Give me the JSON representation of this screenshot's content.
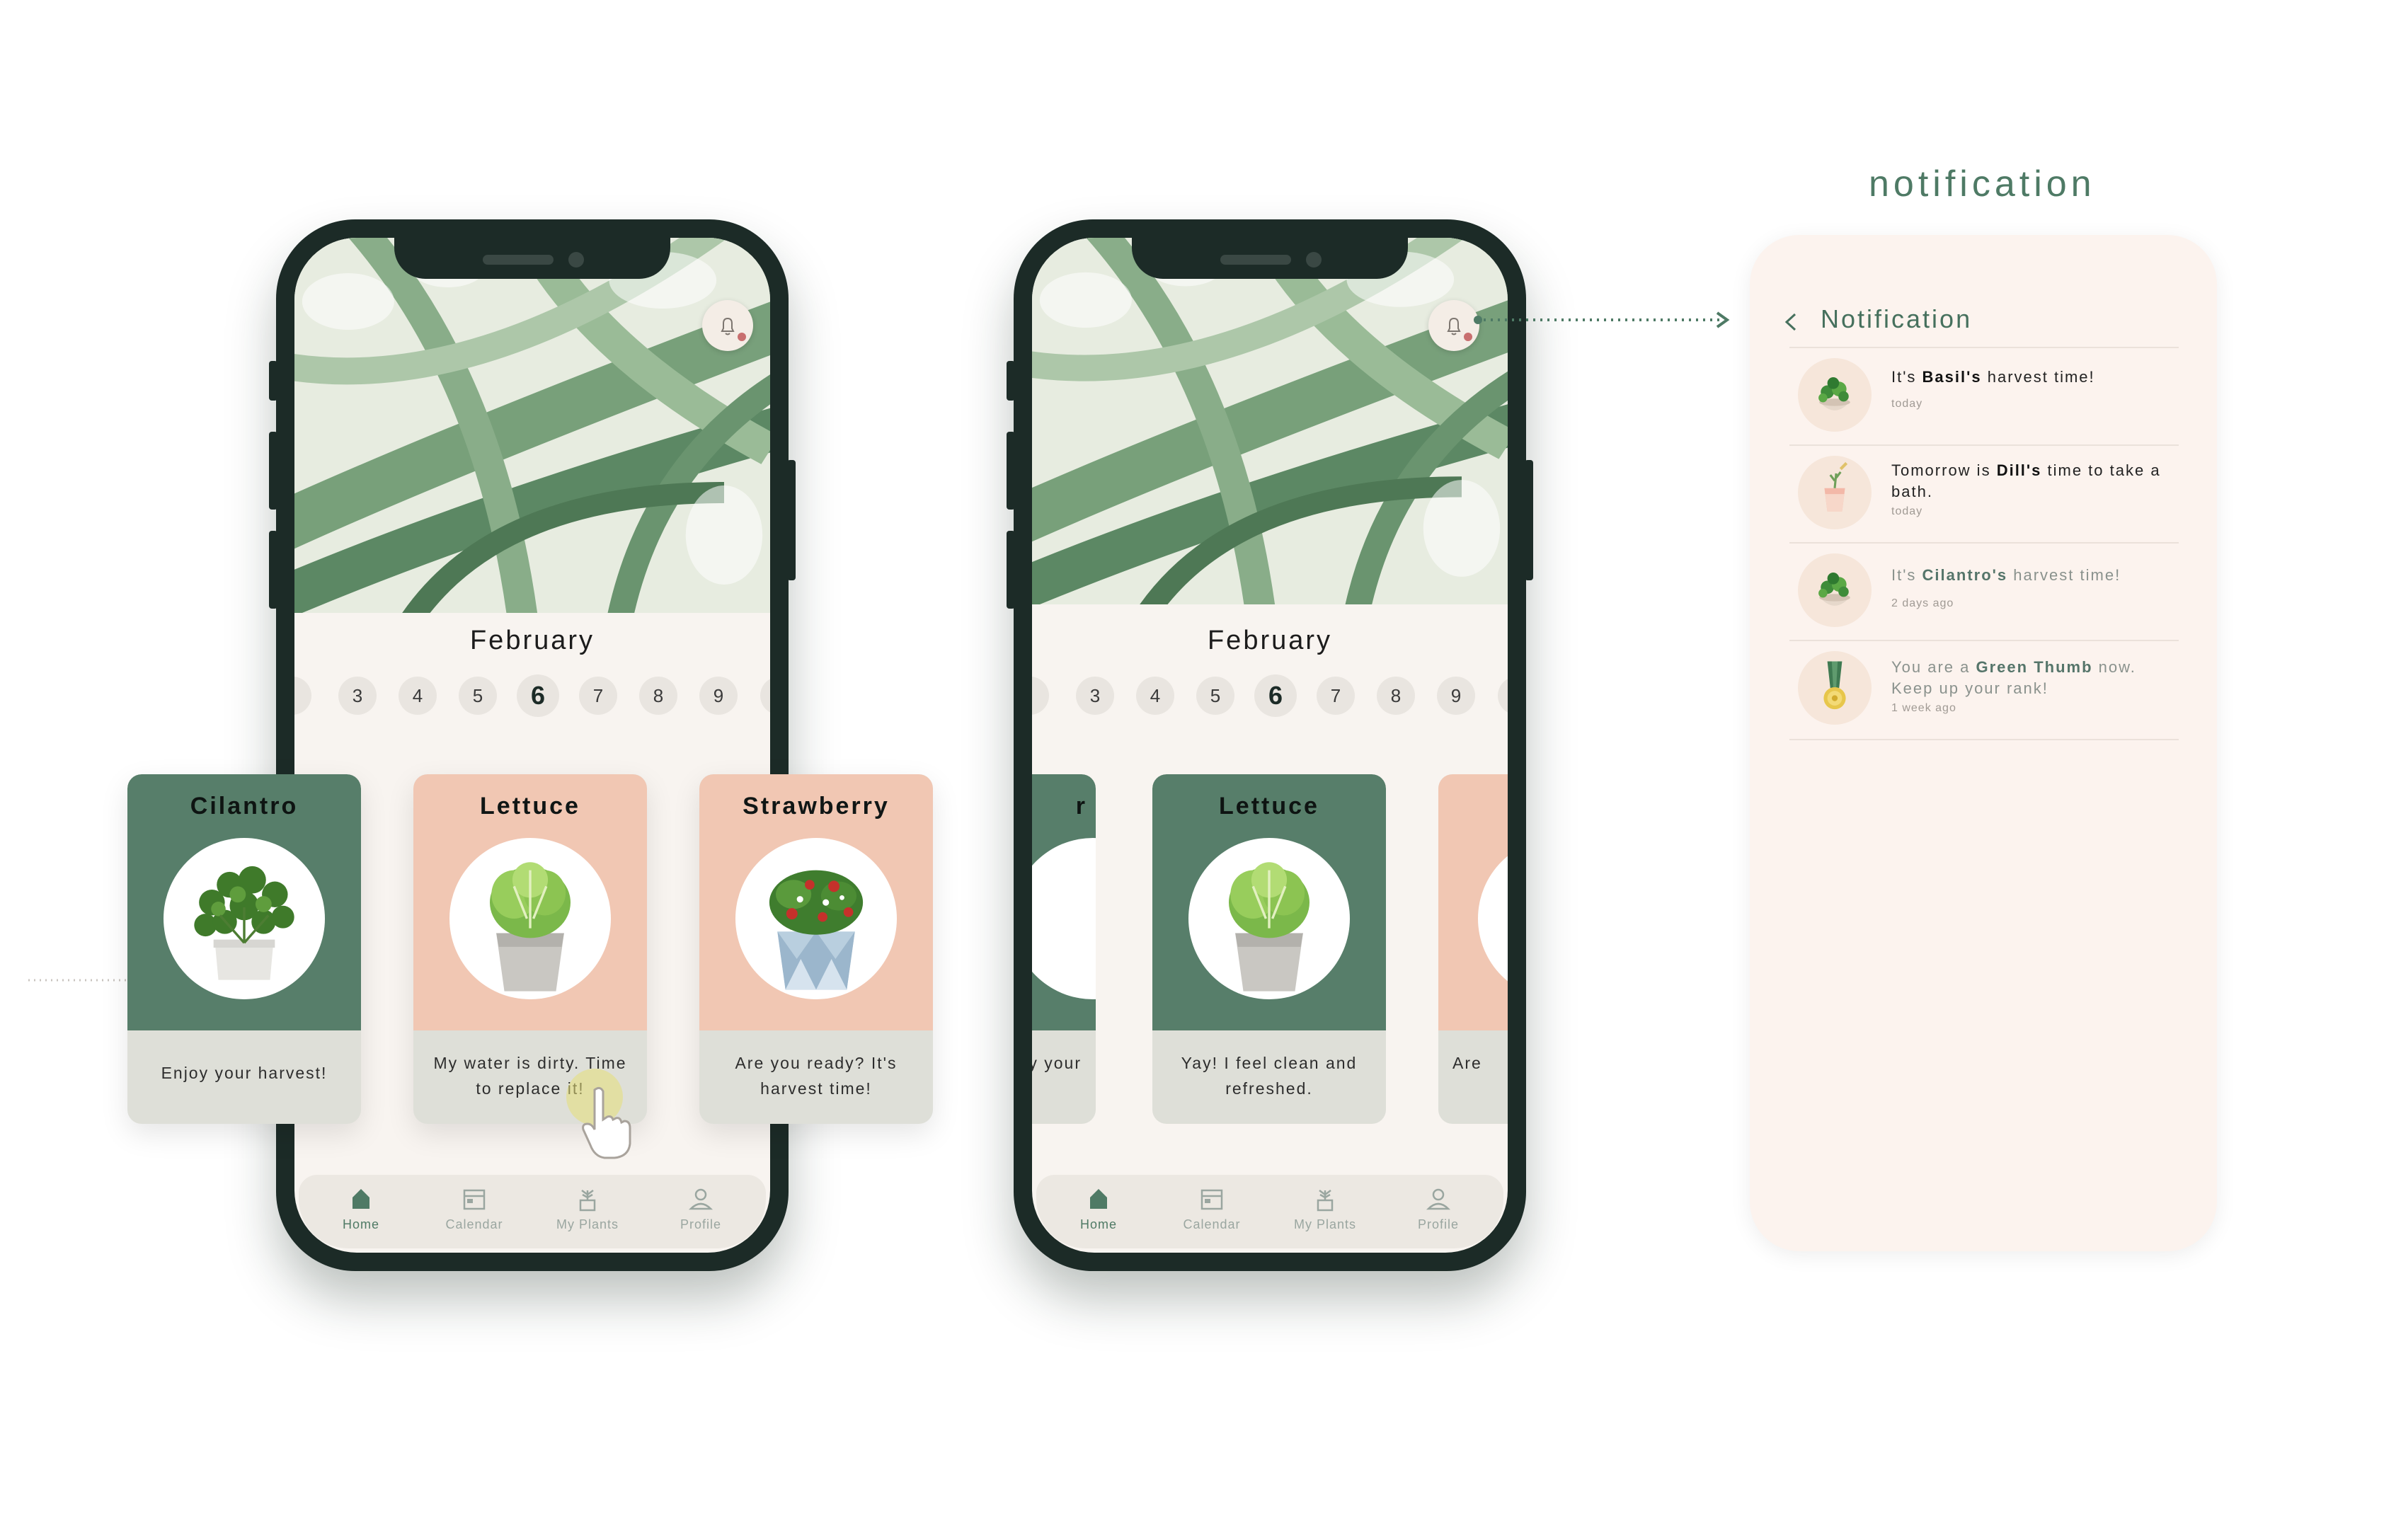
{
  "colors": {
    "brand_green": "#577e6a",
    "peach": "#f1c7b3",
    "frame": "#1c2b27",
    "paper": "#f8f4f0"
  },
  "phone_left": {
    "month": "February",
    "dates": [
      "3",
      "4",
      "5",
      "6",
      "7",
      "8",
      "9"
    ],
    "selected_date": "6",
    "cards": [
      {
        "name": "Cilantro",
        "message": "Enjoy your harvest!"
      },
      {
        "name": "Lettuce",
        "message": "My water is dirty. Time to replace it!"
      },
      {
        "name": "Strawberry",
        "message": "Are you ready? It's harvest time!"
      }
    ]
  },
  "phone_right": {
    "month": "February",
    "dates": [
      "3",
      "4",
      "5",
      "6",
      "7",
      "8",
      "9"
    ],
    "selected_date": "6",
    "card_left_partial": {
      "name_fragment": "r",
      "message_fragment": "y your"
    },
    "card_center": {
      "name": "Lettuce",
      "message": "Yay! I feel clean and refreshed."
    },
    "card_right_partial": {
      "message_fragment": "Are"
    }
  },
  "tabbar": {
    "home": "Home",
    "calendar": "Calendar",
    "my_plants": "My Plants",
    "profile": "Profile"
  },
  "notification": {
    "section_title": "notification",
    "header": "Notification",
    "back_icon": "chevron-left-icon",
    "items": [
      {
        "pre": "It's ",
        "bold": "Basil's",
        "post": " harvest time!",
        "when": "today"
      },
      {
        "pre": "Tomorrow is ",
        "bold": "Dill's",
        "post": " time to take a bath.",
        "when": "today"
      },
      {
        "pre": "It's ",
        "bold": "Cilantro's",
        "post": " harvest time!",
        "when": "2 days ago"
      },
      {
        "pre": "You are a ",
        "bold": "Green Thumb",
        "post": " now. Keep up your rank!",
        "when": "1 week ago"
      }
    ]
  }
}
